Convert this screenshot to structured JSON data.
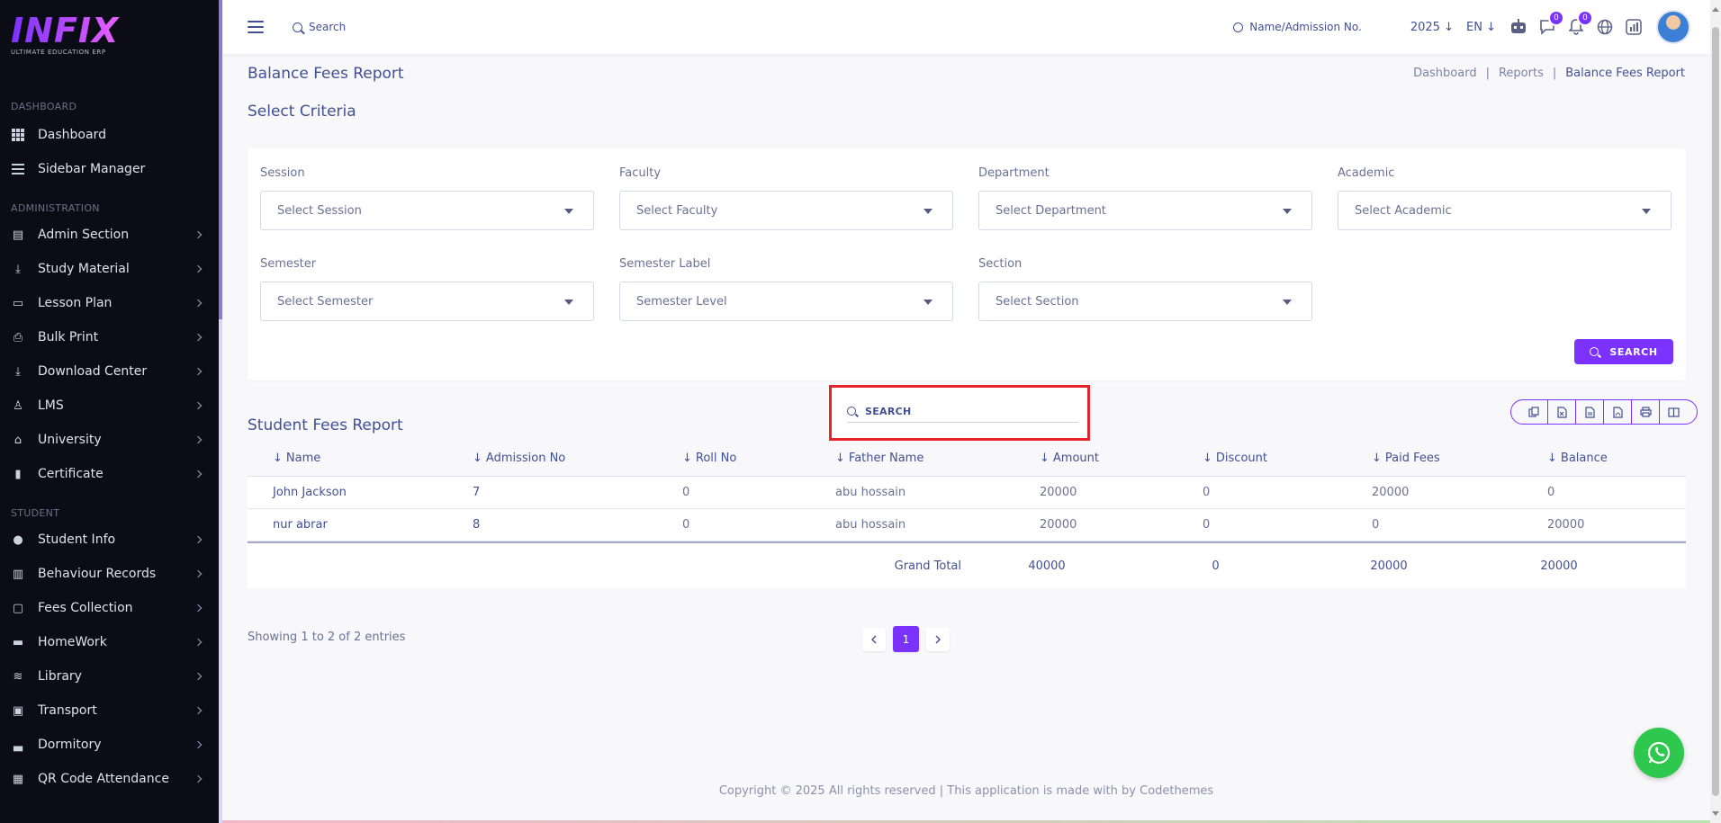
{
  "logo": {
    "text": "INFIX",
    "subtitle": "ULTIMATE EDUCATION ERP"
  },
  "sidebar": {
    "sections": [
      {
        "title": "DASHBOARD",
        "items": [
          {
            "label": "Dashboard",
            "icon": "grid-icon",
            "chevron": false
          },
          {
            "label": "Sidebar Manager",
            "icon": "menu-icon",
            "chevron": false
          }
        ]
      },
      {
        "title": "ADMINISTRATION",
        "items": [
          {
            "label": "Admin Section",
            "icon": "admin-icon",
            "chevron": true
          },
          {
            "label": "Study Material",
            "icon": "download-icon",
            "chevron": true
          },
          {
            "label": "Lesson Plan",
            "icon": "lesson-icon",
            "chevron": true
          },
          {
            "label": "Bulk Print",
            "icon": "print-icon",
            "chevron": true
          },
          {
            "label": "Download Center",
            "icon": "download-icon",
            "chevron": true
          },
          {
            "label": "LMS",
            "icon": "lms-icon",
            "chevron": true
          },
          {
            "label": "University",
            "icon": "university-icon",
            "chevron": true
          },
          {
            "label": "Certificate",
            "icon": "certificate-icon",
            "chevron": true
          }
        ]
      },
      {
        "title": "STUDENT",
        "items": [
          {
            "label": "Student Info",
            "icon": "user-icon",
            "chevron": true
          },
          {
            "label": "Behaviour Records",
            "icon": "records-icon",
            "chevron": true
          },
          {
            "label": "Fees Collection",
            "icon": "fees-icon",
            "chevron": true
          },
          {
            "label": "HomeWork",
            "icon": "book-icon",
            "chevron": true
          },
          {
            "label": "Library",
            "icon": "library-icon",
            "chevron": true
          },
          {
            "label": "Transport",
            "icon": "bus-icon",
            "chevron": true
          },
          {
            "label": "Dormitory",
            "icon": "bed-icon",
            "chevron": true
          },
          {
            "label": "QR Code Attendance",
            "icon": "qr-icon",
            "chevron": true
          }
        ]
      }
    ]
  },
  "header": {
    "search_label": "Search",
    "admission_search": "Name/Admission No.",
    "year": "2025",
    "language": "EN",
    "chat_count": "0",
    "notification_count": "0"
  },
  "page": {
    "title": "Balance Fees Report",
    "breadcrumb": [
      "Dashboard",
      "Reports",
      "Balance Fees Report"
    ],
    "criteria_title": "Select Criteria",
    "fields": [
      {
        "label": "Session",
        "value": "Select Session"
      },
      {
        "label": "Faculty",
        "value": "Select Faculty"
      },
      {
        "label": "Department",
        "value": "Select Department"
      },
      {
        "label": "Academic",
        "value": "Select Academic"
      },
      {
        "label": "Semester",
        "value": "Select Semester"
      },
      {
        "label": "Semester Label",
        "value": "Semester Level"
      },
      {
        "label": "Section",
        "value": "Select Section"
      }
    ],
    "search_button": "SEARCH",
    "table_search_placeholder": "SEARCH",
    "report_title": "Student Fees Report"
  },
  "table": {
    "columns": [
      "Name",
      "Admission No",
      "Roll No",
      "Father Name",
      "Amount",
      "Discount",
      "Paid Fees",
      "Balance"
    ],
    "rows": [
      [
        "John Jackson",
        "7",
        "0",
        "abu hossain",
        "20000",
        "0",
        "20000",
        "0"
      ],
      [
        "nur abrar",
        "8",
        "0",
        "abu hossain",
        "20000",
        "0",
        "0",
        "20000"
      ]
    ],
    "grand_total_label": "Grand Total",
    "totals": [
      "40000",
      "0",
      "20000",
      "20000"
    ]
  },
  "pagination": {
    "entries_text": "Showing 1 to 2 of 2 entries",
    "current_page": "1"
  },
  "footer": {
    "copyright": "Copyright © 2025 All rights reserved | This application is made with by Codethemes"
  },
  "colors": {
    "accent": "#7c32ff",
    "text": "#415094",
    "sidebar_bg": "#0c0c16",
    "highlight": "#e8242b",
    "whatsapp": "#2ec84e"
  }
}
